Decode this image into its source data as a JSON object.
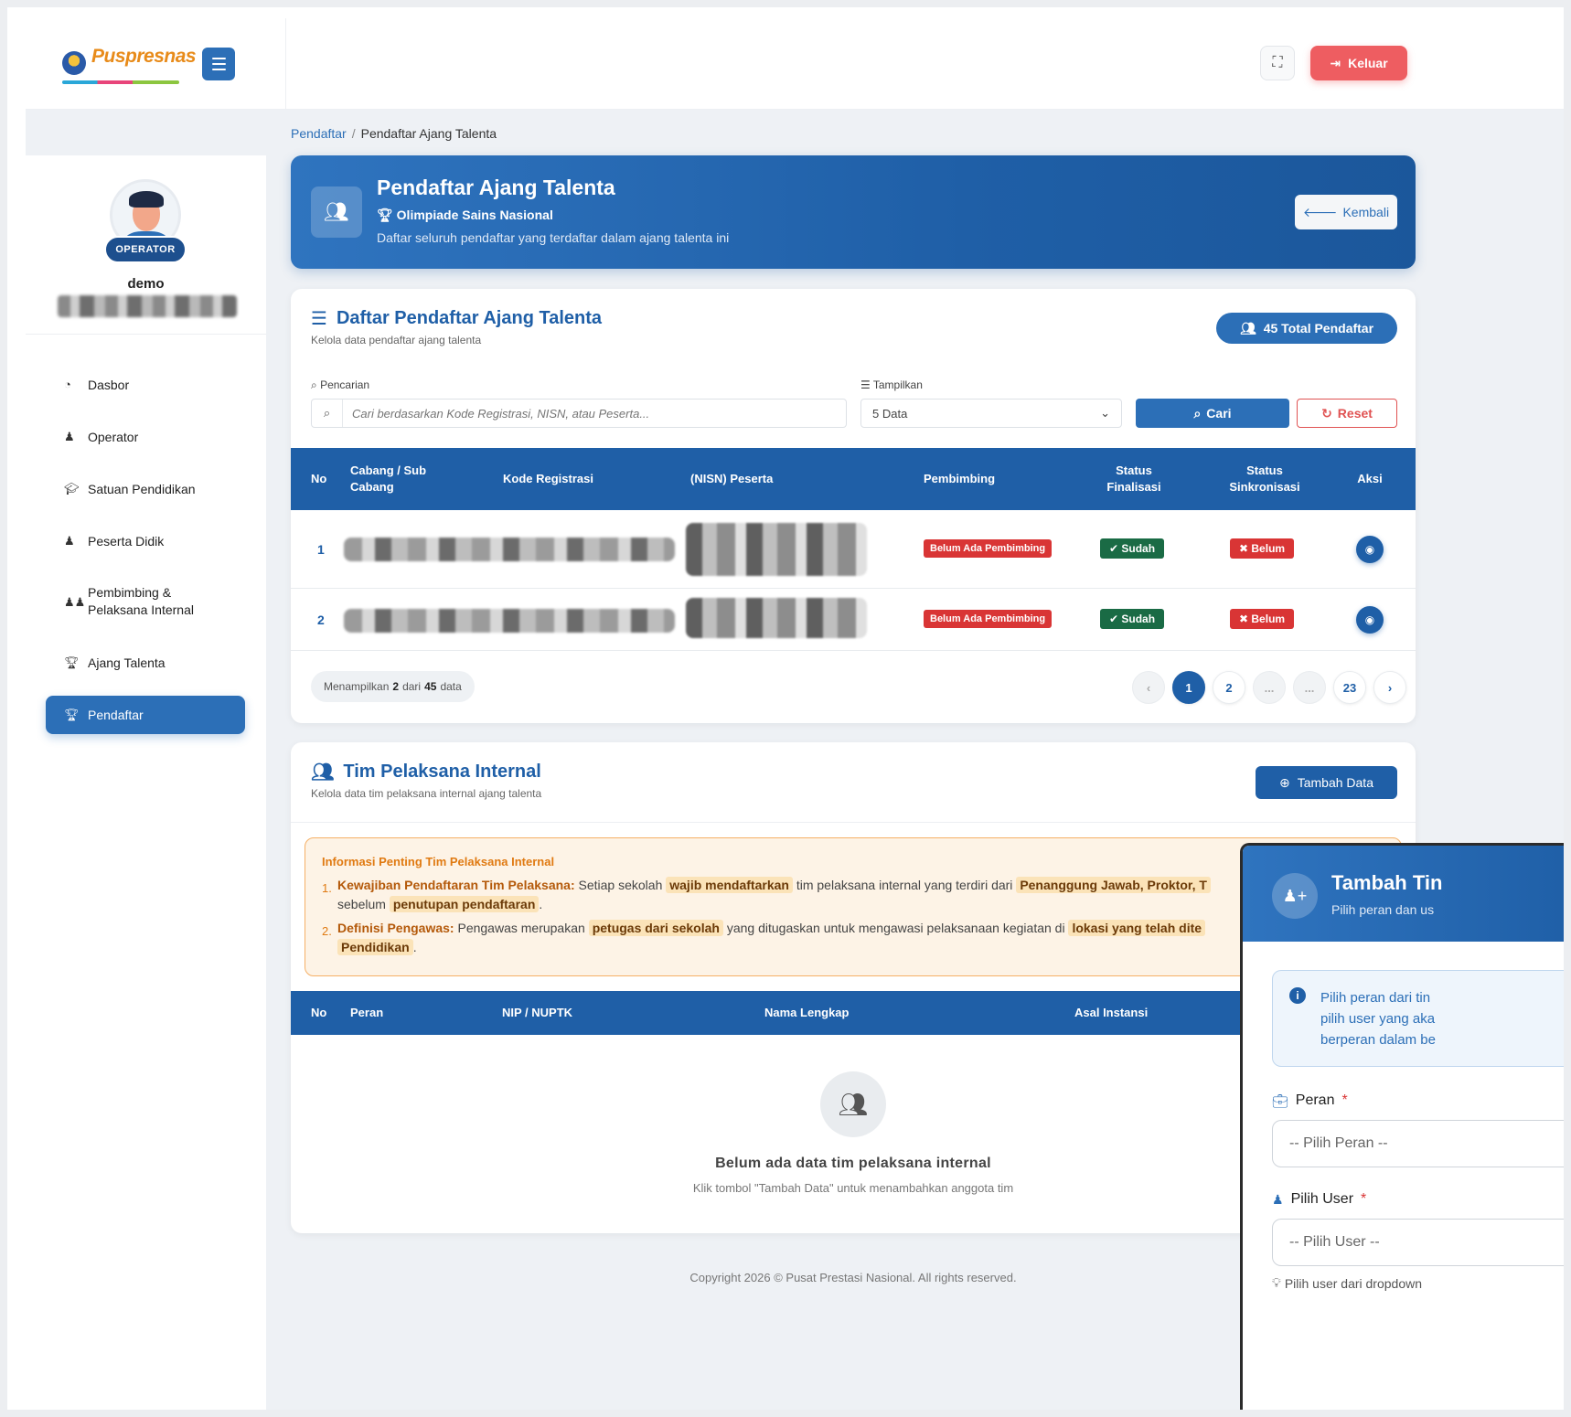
{
  "app": {
    "logo_text": "Puspresnas",
    "fullscreen_icon": "fullscreen-icon",
    "logout_label": "Keluar"
  },
  "sidebar": {
    "role_badge": "OPERATOR",
    "username": "demo",
    "items": [
      {
        "label": "Dasbor",
        "icon": "dashboard-icon"
      },
      {
        "label": "Operator",
        "icon": "user-icon"
      },
      {
        "label": "Satuan Pendidikan",
        "icon": "graduation-cap-icon"
      },
      {
        "label": "Peserta Didik",
        "icon": "user-icon"
      },
      {
        "label": "Pembimbing & Pelaksana Internal",
        "icon": "users-icon"
      },
      {
        "label": "Ajang Talenta",
        "icon": "trophy-icon"
      },
      {
        "label": "Pendaftar",
        "icon": "trophy-icon",
        "active": true
      }
    ]
  },
  "breadcrumb": {
    "parent": "Pendaftar",
    "separator": "/",
    "current": "Pendaftar Ajang Talenta"
  },
  "hero": {
    "title": "Pendaftar Ajang Talenta",
    "subtitle": "Olimpiade Sains Nasional",
    "description": "Daftar seluruh pendaftar yang terdaftar dalam ajang talenta ini",
    "back_label": "Kembali"
  },
  "registrants": {
    "title": "Daftar Pendaftar Ajang Talenta",
    "subtitle": "Kelola data pendaftar ajang talenta",
    "total_badge": "45 Total Pendaftar",
    "search_label": "Pencarian",
    "search_placeholder": "Cari berdasarkan Kode Registrasi, NISN, atau Peserta...",
    "show_label": "Tampilkan",
    "show_value": "5 Data",
    "search_button": "Cari",
    "reset_button": "Reset",
    "columns": [
      "No",
      "Cabang / Sub Cabang",
      "Kode Registrasi",
      "(NISN) Peserta",
      "Pembimbing",
      "Status Finalisasi",
      "Status Sinkronisasi",
      "Aksi"
    ],
    "rows": [
      {
        "no": "1",
        "pembimbing": "Belum Ada Pembimbing",
        "finalisasi": "Sudah",
        "sinkronisasi": "Belum"
      },
      {
        "no": "2",
        "pembimbing": "Belum Ada Pembimbing",
        "finalisasi": "Sudah",
        "sinkronisasi": "Belum"
      }
    ],
    "footer_prefix": "Menampilkan",
    "footer_shown": "2",
    "footer_mid": "dari",
    "footer_total": "45",
    "footer_suffix": "data",
    "pages": [
      "1",
      "2",
      "...",
      "...",
      "23"
    ],
    "current_page": "1"
  },
  "team": {
    "title": "Tim Pelaksana Internal",
    "subtitle": "Kelola data tim pelaksana internal ajang talenta",
    "add_button": "Tambah Data",
    "info_title": "Informasi Penting Tim Pelaksana Internal",
    "info_1": {
      "num": "1.",
      "key": "Kewajiban Pendaftaran Tim Pelaksana:",
      "t1": "Setiap sekolah",
      "h1": "wajib mendaftarkan",
      "t2": "tim pelaksana internal yang terdiri dari",
      "h2": "Penanggung Jawab, Proktor, T",
      "t3": "sebelum",
      "h3": "penutupan pendaftaran",
      "t4": "."
    },
    "info_2": {
      "num": "2.",
      "key": "Definisi Pengawas:",
      "t1": "Pengawas merupakan",
      "h1": "petugas dari sekolah",
      "t2": "yang ditugaskan untuk mengawasi pelaksanaan kegiatan di",
      "h2": "lokasi yang telah dite",
      "h3": "Pendidikan",
      "t3": "."
    },
    "columns": [
      "No",
      "Peran",
      "NIP / NUPTK",
      "Nama Lengkap",
      "Asal Instansi"
    ],
    "empty_title": "Belum ada data tim pelaksana internal",
    "empty_sub": "Klik tombol \"Tambah Data\" untuk menambahkan anggota tim"
  },
  "footer": {
    "copyright": "Copyright 2026 © Pusat Prestasi Nasional. All rights reserved."
  },
  "modal": {
    "title": "Tambah Tin",
    "subtitle": "Pilih peran dan us",
    "info_line1": "Pilih peran dari tin",
    "info_line2": "pilih user yang aka",
    "info_line3": "berperan dalam be",
    "role_label": "Peran",
    "role_placeholder": "-- Pilih Peran --",
    "user_label": "Pilih User",
    "user_placeholder": "-- Pilih User --",
    "required_mark": "*",
    "hint": "Pilih user dari dropdown"
  },
  "colors": {
    "primary": "#1f5fa7",
    "accent": "#2c6fb7",
    "danger": "#d93535",
    "success": "#1a6b45",
    "logout": "#ee5d61",
    "warning_bg": "#fdf3e6"
  }
}
